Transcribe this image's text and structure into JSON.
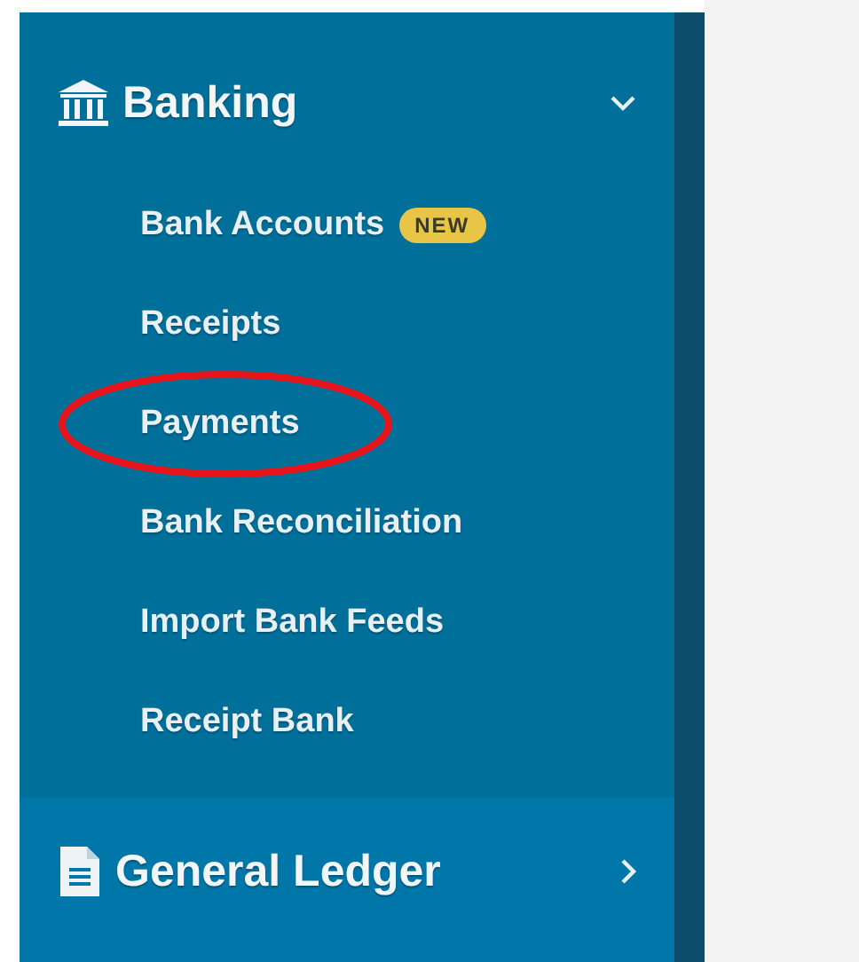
{
  "sidebar": {
    "sections": [
      {
        "label": "Banking",
        "kind": "bank",
        "expanded": true,
        "items": [
          {
            "label": "Bank Accounts",
            "badge": "NEW",
            "highlighted": false
          },
          {
            "label": "Receipts",
            "highlighted": false
          },
          {
            "label": "Payments",
            "highlighted": true
          },
          {
            "label": "Bank Reconciliation",
            "highlighted": false
          },
          {
            "label": "Import Bank Feeds",
            "highlighted": false
          },
          {
            "label": "Receipt Bank",
            "highlighted": false
          }
        ]
      },
      {
        "label": "General Ledger",
        "kind": "document",
        "expanded": false
      }
    ]
  }
}
